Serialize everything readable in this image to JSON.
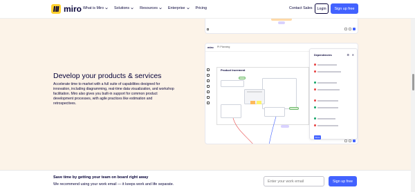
{
  "header": {
    "logo_text": "miro",
    "nav": [
      {
        "label": "What is Miro",
        "has_dropdown": true
      },
      {
        "label": "Solutions",
        "has_dropdown": true
      },
      {
        "label": "Resources",
        "has_dropdown": true
      },
      {
        "label": "Enterprise",
        "has_dropdown": true
      },
      {
        "label": "Pricing",
        "has_dropdown": false
      }
    ],
    "contact_sales": "Contact Sales",
    "login": "Login",
    "signup": "Sign up free"
  },
  "feature": {
    "title": "Develop your products & services",
    "description": "Accelerate time to market with a full suite of capabilities designed for innovation, including diagramming, real-time data visualization, and workshop facilitation. Miro also gives you built-in support for common product development processes, with agile practices like estimation and retrospectives."
  },
  "screenshot": {
    "board_name": "miro",
    "board_title": "PI Planning",
    "frame_title": "Product Increment",
    "panel_title": "Dependencies",
    "panel_done_label": "Done",
    "colors": {
      "accent": "#4262ff",
      "blocked": "#e84a4a",
      "ok": "#1ea86e",
      "sticky_yellow": "#fff36b",
      "sticky_orange": "#ffb95a",
      "chip_purple": "#d9d2ff"
    }
  },
  "banner": {
    "title": "Save time by getting your team on board right away",
    "subtitle": "We recommend using your work email — it keeps work and life separate.",
    "email_placeholder": "Enter your work email",
    "signup": "Sign up free"
  },
  "colors": {
    "brand_yellow": "#ffd02f",
    "primary_blue": "#4262ff",
    "page_bg": "#fcf3e8",
    "text_dark": "#050038"
  }
}
